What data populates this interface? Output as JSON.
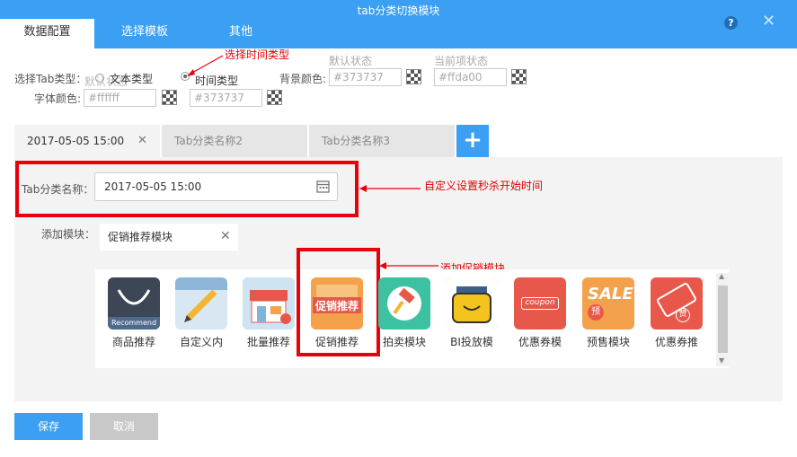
{
  "window": {
    "title": "tab分类切换模块",
    "help": "?",
    "close": "✕"
  },
  "tabs": [
    {
      "label": "数据配置"
    },
    {
      "label": "选择模板"
    },
    {
      "label": "其他"
    }
  ],
  "config": {
    "tab_type_label": "选择Tab类型：",
    "ghost_text": "默认状态",
    "options": [
      {
        "label": "文本类型"
      },
      {
        "label": "时间类型"
      }
    ],
    "bg_color_label": "背景颜色:",
    "font_color_label": "字体颜色:",
    "default_state_label": "默认状态",
    "current_state_label": "当前项状态",
    "bg_default_value": "#373737",
    "bg_current_value": "#ffda00",
    "font_default_value": "#ffffff",
    "font_current_value": "#373737"
  },
  "annotations": {
    "select_time_type": "选择时间类型",
    "custom_start_time": "自定义设置秒杀开始时间",
    "add_promo_module": "添加促销模块"
  },
  "category_tabs": [
    {
      "label": "2017-05-05 15:00",
      "close": "✕"
    },
    {
      "label": "Tab分类名称2"
    },
    {
      "label": "Tab分类名称3"
    }
  ],
  "add_tab": "+",
  "form": {
    "name_label": "Tab分类名称：",
    "name_value": "2017-05-05 15:00",
    "module_label": "添加模块：",
    "module_value": "促销推荐模块",
    "module_clear": "✕"
  },
  "modules": [
    {
      "label": "商品推荐",
      "icon": "recommend-icon",
      "badge": "Recommend",
      "color": "#3d4654"
    },
    {
      "label": "自定义内",
      "icon": "pencil-icon",
      "color": "#d9e7f3"
    },
    {
      "label": "批量推荐",
      "icon": "shop-icon",
      "color": "#7fb5d9"
    },
    {
      "label": "促销推荐",
      "icon": "promo-icon",
      "badge": "促销推荐",
      "color": "#f08a3a"
    },
    {
      "label": "拍卖模块",
      "icon": "gavel-icon",
      "color": "#3cc1a1"
    },
    {
      "label": "BI投放模",
      "icon": "bag-icon",
      "color": "#6e8ba6"
    },
    {
      "label": "优惠券模",
      "icon": "coupon-icon",
      "badge": "coupon",
      "color": "#e8584a"
    },
    {
      "label": "预售模块",
      "icon": "sale-icon",
      "badge": "SALE",
      "badge2": "预",
      "color": "#f3a24b"
    },
    {
      "label": "优惠券推",
      "icon": "ticket-icon",
      "badge": "赞",
      "color": "#e8584a"
    }
  ],
  "footer": {
    "save": "保存",
    "cancel": "取消"
  },
  "colors": {
    "accent": "#3b9ff3",
    "annotation": "#e8000b",
    "disabled": "#c8c8c8"
  }
}
